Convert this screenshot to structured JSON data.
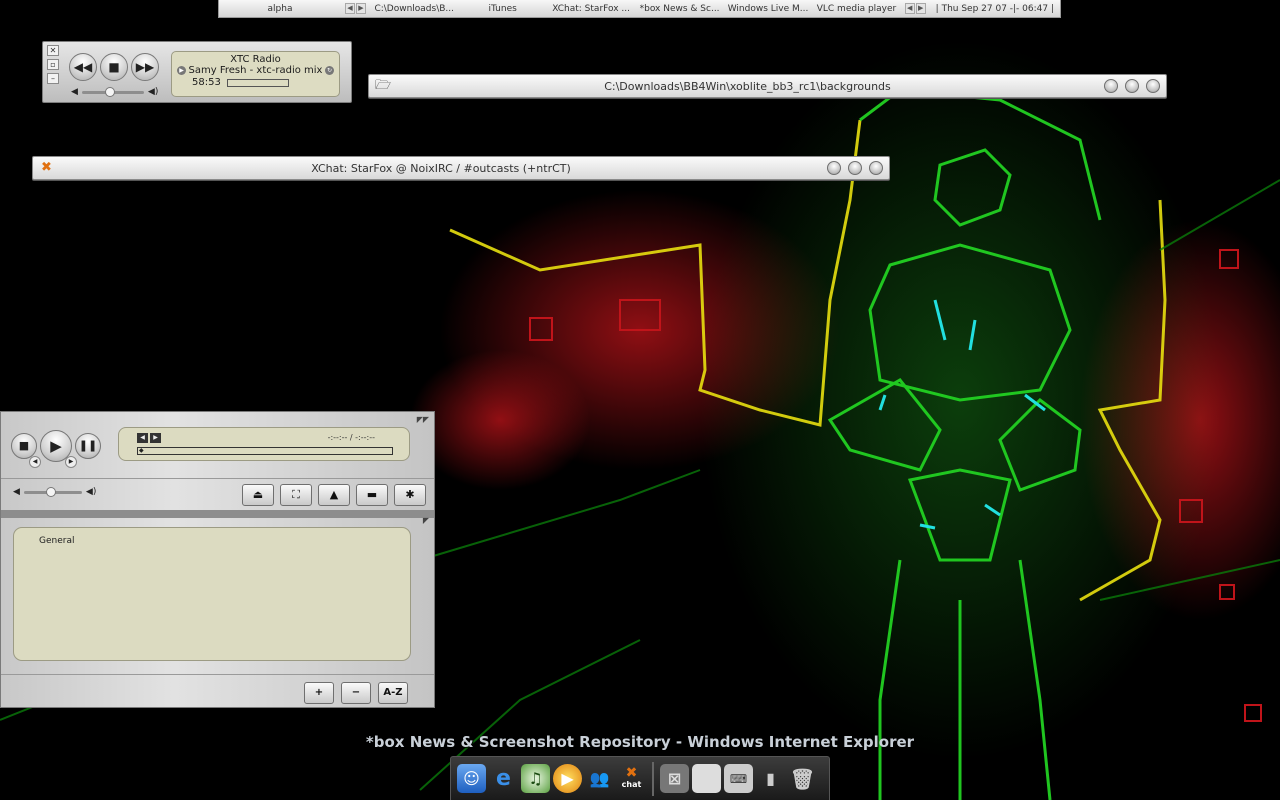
{
  "taskbar": {
    "workspace": "alpha",
    "tasks": [
      "C:\\Downloads\\B...",
      "iTunes",
      "XChat: StarFox ...",
      "*box News & Sc...",
      "Windows Live M...",
      "VLC media player"
    ],
    "clock": "| Thu Sep 27 07 -|- 06:47 |"
  },
  "radio": {
    "station": "XTC Radio",
    "track": "Samy Fresh - xtc-radio mix",
    "time": "58:53",
    "volume_fraction": 0.45
  },
  "explorer_window": {
    "title": "C:\\Downloads\\BB4Win\\xoblite_bb3_rc1\\backgrounds"
  },
  "xchat_window": {
    "title": "XChat: StarFox @ NoixIRC / #outcasts (+ntrCT)"
  },
  "player": {
    "time_display": "-:--:-- / -:--:--",
    "volume_fraction": 0.45,
    "playlist_label": "General",
    "buttons": {
      "add": "+",
      "remove": "−",
      "sort": "A-Z"
    }
  },
  "caption": "*box News & Screenshot Repository - Windows Internet Explorer",
  "dock": {
    "icons": [
      "finder-icon",
      "internet-explorer-icon",
      "itunes-icon",
      "media-player-icon",
      "messenger-icon",
      "xchat-icon",
      "blackbox-icon",
      "apple-icon",
      "keyboard-icon",
      "system-icon",
      "trash-icon"
    ],
    "xchat_label": "chat"
  },
  "colors": {
    "wallpaper_green": "#22d022",
    "wallpaper_red": "#c0141a",
    "wallpaper_yellow": "#e8e010",
    "lcd": "#dcdbc1"
  }
}
